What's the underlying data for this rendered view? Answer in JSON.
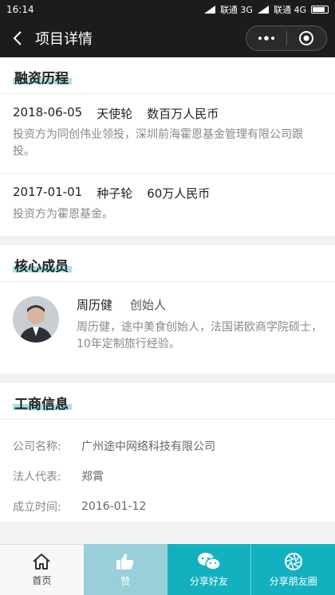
{
  "status": {
    "time": "16:14",
    "carrier1": "联通 3G",
    "carrier2": "联通 4G"
  },
  "nav": {
    "title": "项目详情"
  },
  "funding": {
    "title": "融资历程",
    "rounds": [
      {
        "date": "2018-06-05",
        "stage": "天使轮",
        "amount": "数百万人民币",
        "desc": "投资方为同创伟业领投，深圳前海霍恩基金管理有限公司跟投。"
      },
      {
        "date": "2017-01-01",
        "stage": "种子轮",
        "amount": "60万人民币",
        "desc": "投资方为霍恩基金。"
      }
    ]
  },
  "team": {
    "title": "核心成员",
    "members": [
      {
        "name": "周历健",
        "role": "创始人",
        "desc": "周历健，途中美食创始人，法国诺欧商学院硕士，10年定制旅行经验。"
      }
    ]
  },
  "business": {
    "title": "工商信息",
    "rows": [
      {
        "label": "公司名称:",
        "value": "广州途中网络科技有限公司"
      },
      {
        "label": "法人代表:",
        "value": "郑霄"
      },
      {
        "label": "成立时间:",
        "value": "2016-01-12"
      }
    ]
  },
  "tabbar": {
    "home": "首页",
    "like": "赞",
    "share_friend": "分享好友",
    "share_moments": "分享朋友圈"
  },
  "colors": {
    "accent": "#13b1c0",
    "like": "#98cfd8",
    "highlight": "#a8e3e8"
  }
}
